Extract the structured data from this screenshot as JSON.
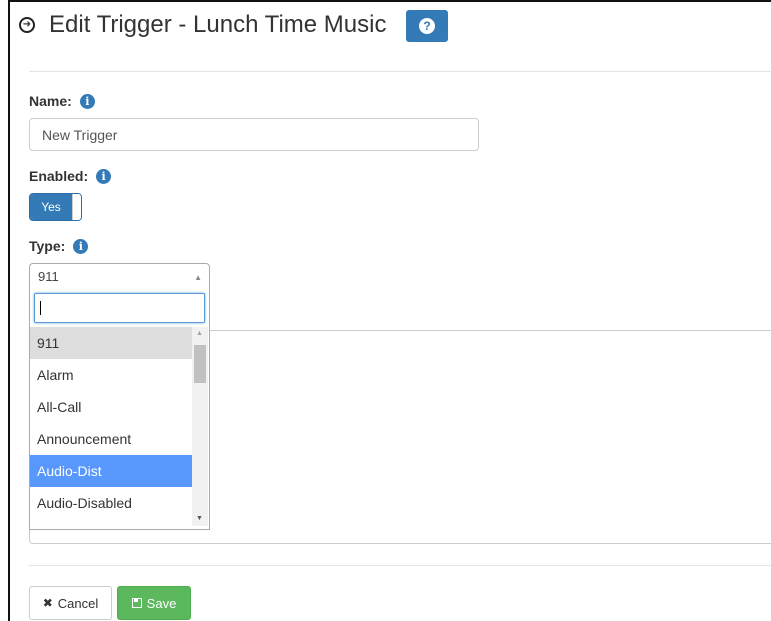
{
  "header": {
    "title": "Edit Trigger - Lunch Time Music",
    "help_icon": "question-icon",
    "title_icon": "circle-arrow-right-icon"
  },
  "form": {
    "name": {
      "label": "Name:",
      "value": "New Trigger",
      "info_icon": "info-icon"
    },
    "enabled": {
      "label": "Enabled:",
      "toggle_text": "Yes",
      "state": true
    },
    "type": {
      "label": "Type:",
      "selected": "911",
      "search_value": "",
      "options": [
        {
          "label": "911",
          "state": "hover"
        },
        {
          "label": "Alarm",
          "state": ""
        },
        {
          "label": "All-Call",
          "state": ""
        },
        {
          "label": "Announcement",
          "state": ""
        },
        {
          "label": "Audio-Dist",
          "state": "selected"
        },
        {
          "label": "Audio-Disabled",
          "state": ""
        }
      ]
    }
  },
  "buttons": {
    "cancel": "Cancel",
    "save": "Save"
  },
  "colors": {
    "primary": "#337ab7",
    "success": "#5cb85c",
    "highlight": "#5897fb"
  }
}
